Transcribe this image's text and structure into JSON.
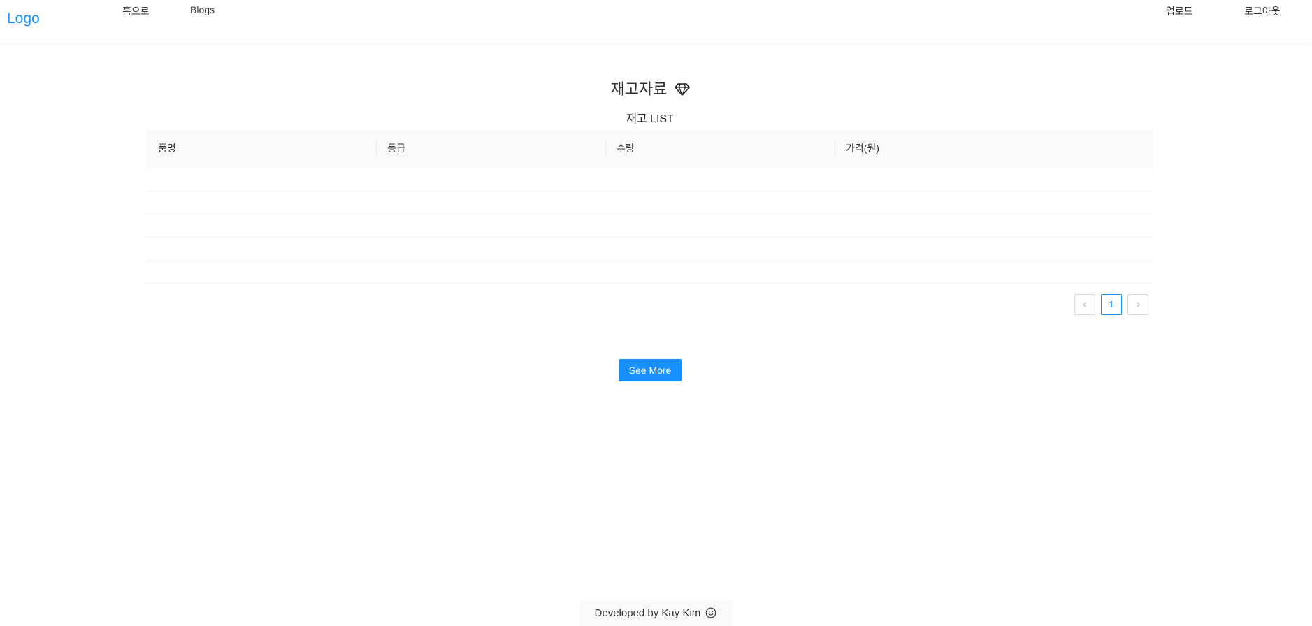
{
  "header": {
    "logo": "Logo",
    "nav_left": [
      "홈으로",
      "Blogs"
    ],
    "nav_right": [
      "업로드",
      "로그아웃"
    ]
  },
  "main": {
    "title": "재고자료",
    "title_icon": "diamond-icon",
    "list_title": "재고 LIST",
    "table": {
      "columns": [
        "품명",
        "등급",
        "수량",
        "가격(원)"
      ],
      "rows": [
        [],
        [],
        [],
        [],
        []
      ]
    },
    "pagination": {
      "current_page": "1",
      "prev_icon": "chevron-left-icon",
      "next_icon": "chevron-right-icon"
    },
    "see_more_label": "See More"
  },
  "footer": {
    "text": "Developed by Kay Kim",
    "icon": "smile-icon"
  },
  "colors": {
    "accent": "#1890ff",
    "header_bg": "#ffffff",
    "table_header_bg": "#fafafa"
  }
}
